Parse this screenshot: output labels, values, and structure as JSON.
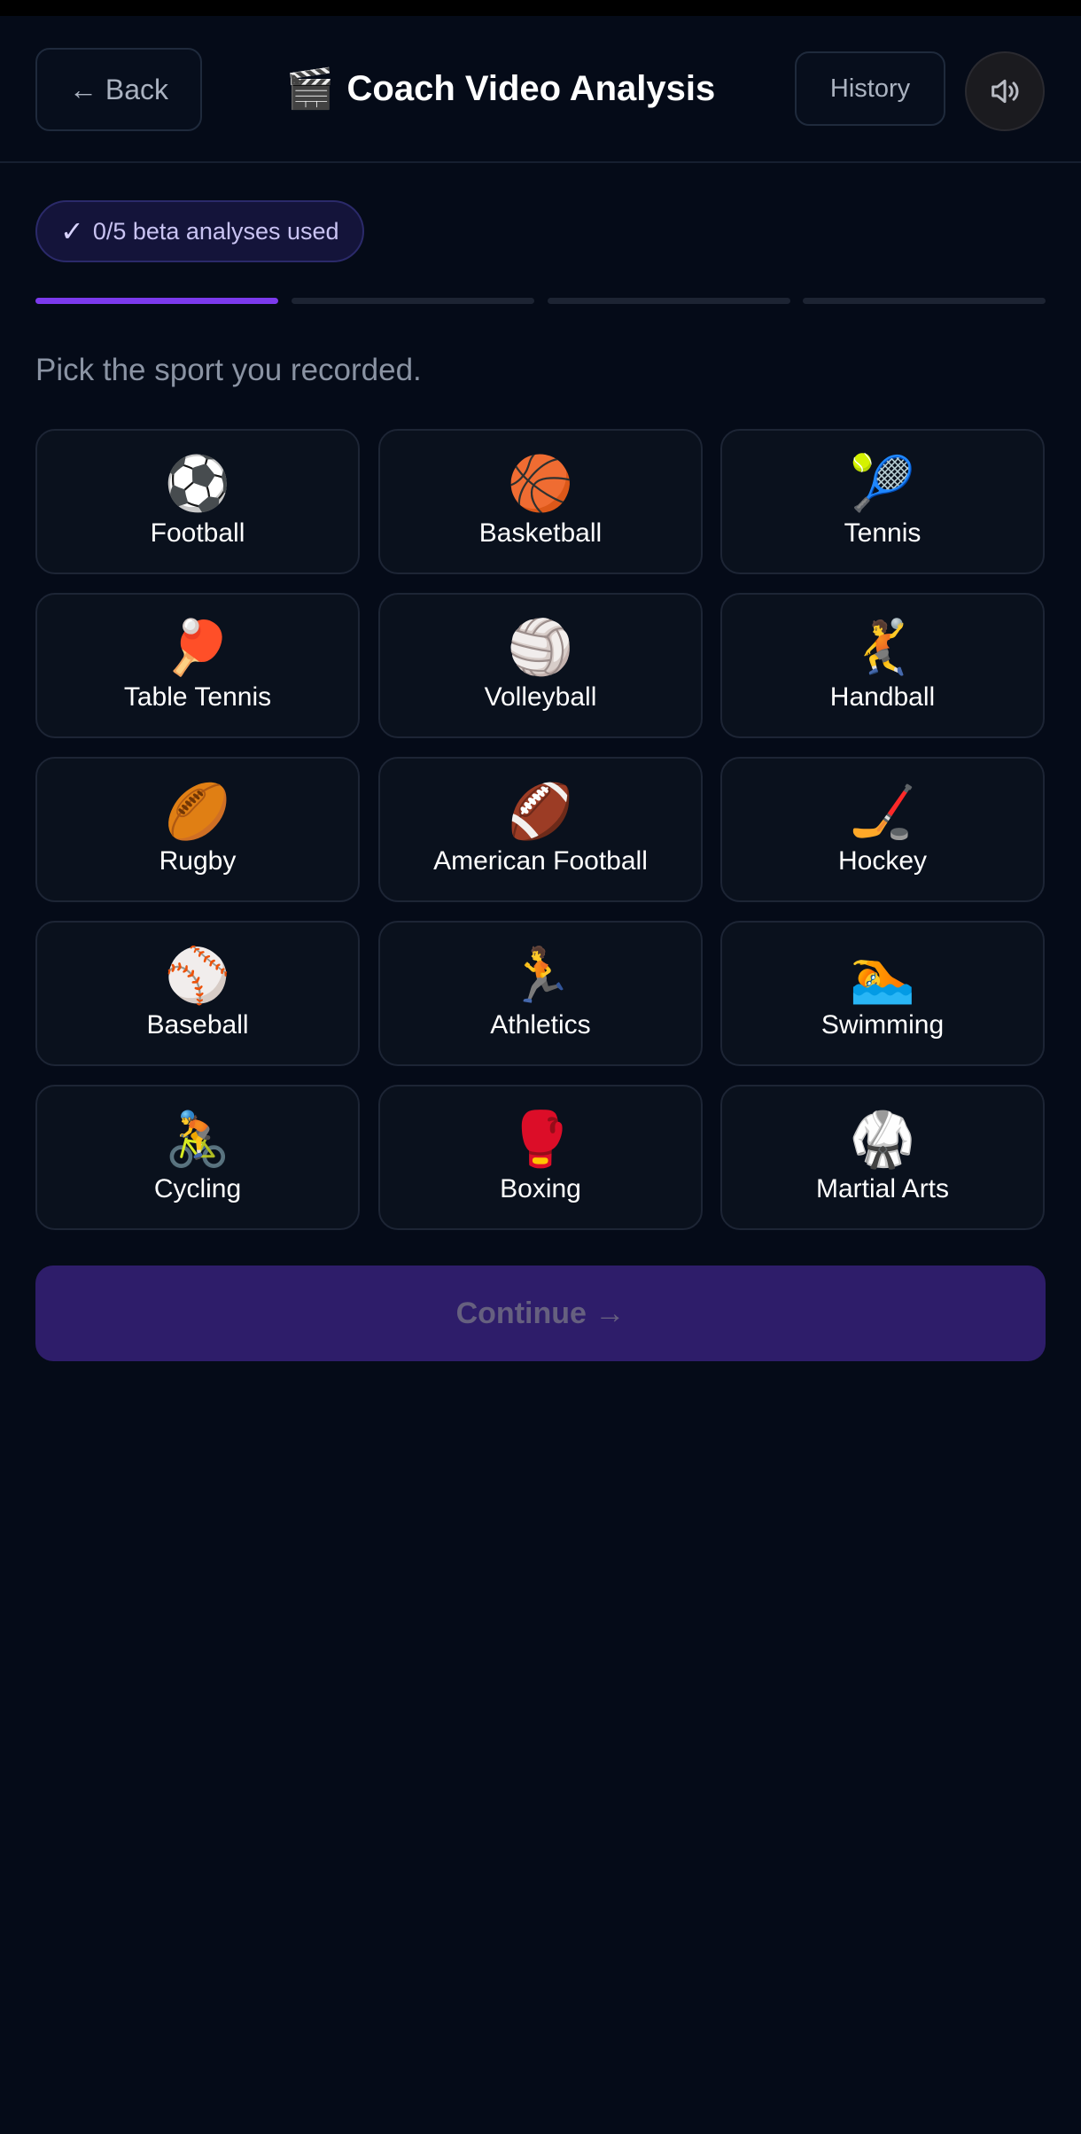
{
  "header": {
    "back_label": "← Back",
    "title_icon": "🎬",
    "title": "Coach Video Analysis",
    "history_label": "History",
    "sound_icon": "speaker-icon"
  },
  "beta": {
    "check": "✓",
    "text": "0/5 beta analyses used"
  },
  "progress": {
    "steps_total": 4,
    "current_step": 1,
    "accent_color": "#7c3aed"
  },
  "prompt": "Pick the sport you recorded.",
  "sports": [
    {
      "emoji": "⚽",
      "label": "Football"
    },
    {
      "emoji": "🏀",
      "label": "Basketball"
    },
    {
      "emoji": "🎾",
      "label": "Tennis"
    },
    {
      "emoji": "🏓",
      "label": "Table Tennis"
    },
    {
      "emoji": "🏐",
      "label": "Volleyball"
    },
    {
      "emoji": "🤾",
      "label": "Handball"
    },
    {
      "emoji": "🏉",
      "label": "Rugby"
    },
    {
      "emoji": "🏈",
      "label": "American Football"
    },
    {
      "emoji": "🏒",
      "label": "Hockey"
    },
    {
      "emoji": "⚾",
      "label": "Baseball"
    },
    {
      "emoji": "🏃",
      "label": "Athletics"
    },
    {
      "emoji": "🏊",
      "label": "Swimming"
    },
    {
      "emoji": "🚴",
      "label": "Cycling"
    },
    {
      "emoji": "🥊",
      "label": "Boxing"
    },
    {
      "emoji": "🥋",
      "label": "Martial Arts"
    }
  ],
  "continue_label": "Continue →"
}
